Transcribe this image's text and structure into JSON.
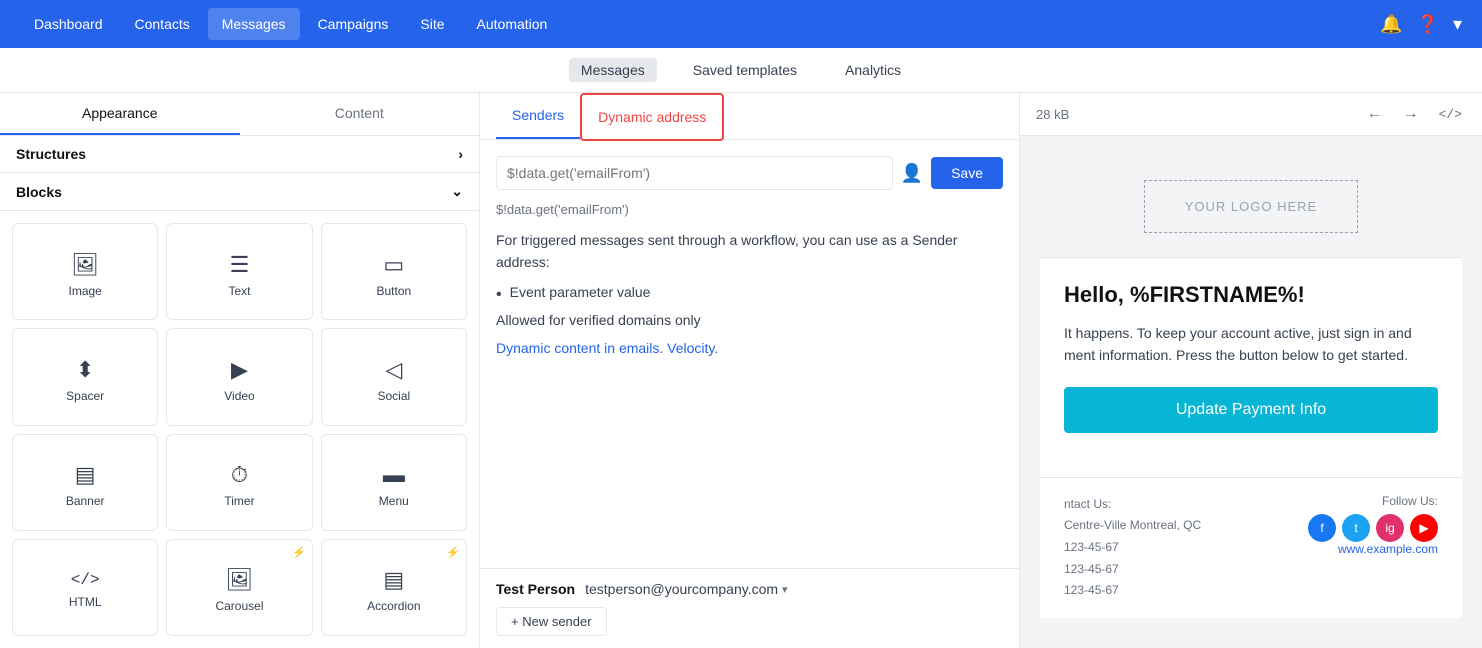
{
  "topNav": {
    "links": [
      {
        "label": "Dashboard",
        "active": false
      },
      {
        "label": "Contacts",
        "active": false
      },
      {
        "label": "Messages",
        "active": true
      },
      {
        "label": "Campaigns",
        "active": false
      },
      {
        "label": "Site",
        "active": false
      },
      {
        "label": "Automation",
        "active": false
      }
    ],
    "icons": [
      "bell",
      "question",
      "chevron-down"
    ]
  },
  "subNav": {
    "items": [
      {
        "label": "Messages",
        "active": true
      },
      {
        "label": "Saved templates",
        "active": false
      },
      {
        "label": "Analytics",
        "active": false
      }
    ]
  },
  "leftSidebar": {
    "appearanceTab": "Appearance",
    "contentTab": "Content",
    "structuresLabel": "Structures",
    "blocksLabel": "Blocks",
    "blocks": [
      {
        "label": "Image",
        "icon": "🖼",
        "bolt": false
      },
      {
        "label": "Text",
        "icon": "☰",
        "bolt": false
      },
      {
        "label": "Button",
        "icon": "⬜",
        "bolt": false
      },
      {
        "label": "Spacer",
        "icon": "⬍",
        "bolt": false
      },
      {
        "label": "Video",
        "icon": "▶",
        "bolt": false
      },
      {
        "label": "Social",
        "icon": "◁",
        "bolt": false
      },
      {
        "label": "Banner",
        "icon": "▤",
        "bolt": false
      },
      {
        "label": "Timer",
        "icon": "◔",
        "bolt": false
      },
      {
        "label": "Menu",
        "icon": "▬",
        "bolt": false
      },
      {
        "label": "HTML",
        "icon": "</>",
        "bolt": false
      },
      {
        "label": "Carousel",
        "icon": "🖼",
        "bolt": true
      },
      {
        "label": "Accordion",
        "icon": "▤",
        "bolt": true
      }
    ]
  },
  "middlePanel": {
    "senderTab": "Senders",
    "dynamicAddressTab": "Dynamic address",
    "senderInputPlaceholder": "$!data.get('emailFrom')",
    "senderInputValue": "",
    "saveButton": "Save",
    "dynamicHint": "$!data.get('emailFrom')",
    "infoText1": "For triggered messages sent through a workflow, you can use as a Sender address:",
    "bulletItem": "Event parameter value",
    "infoNote": "Allowed for verified domains only",
    "dynamicLink": "Dynamic content in emails. Velocity.",
    "testPersonName": "Test Person",
    "testPersonEmail": "testperson@yourcompany.com",
    "newSenderLabel": "+ New sender"
  },
  "rightPanel": {
    "fileSize": "28 kB",
    "toolbar": {
      "backIcon": "←",
      "forwardIcon": "→",
      "codeIcon": "</>"
    },
    "email": {
      "logoPlaceholder": "YOUR LOGO HERE",
      "greeting": "Hello, %FIRSTNAME%!",
      "bodyText": "It happens. To keep your account active, just sign in and ment information. Press the button below to get started.",
      "ctaButton": "Update Payment Info",
      "footerContact": {
        "label": "ntact Us:",
        "address": "Centre-Ville Montreal, QC",
        "phone1": "123-45-67",
        "phone2": "123-45-67",
        "phone3": "123-45-67"
      },
      "footerFollow": {
        "label": "Follow Us:",
        "socialIcons": [
          "f",
          "t",
          "ig",
          "yt"
        ],
        "link": "www.example.com"
      }
    }
  }
}
